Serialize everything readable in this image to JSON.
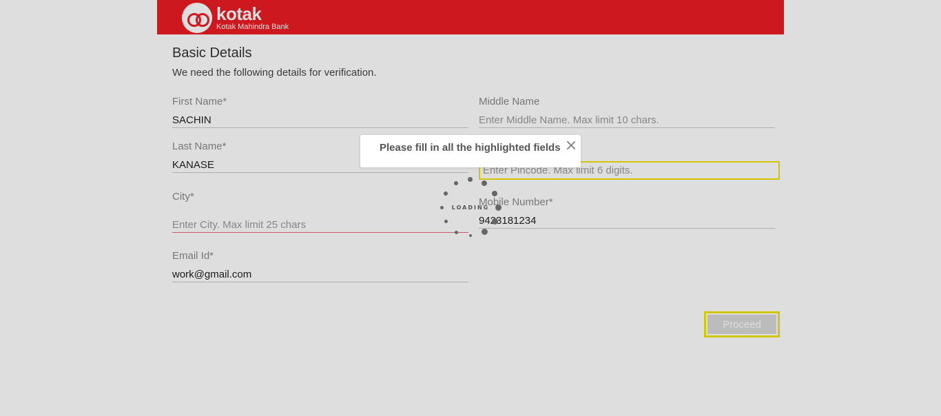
{
  "header": {
    "brand": "kotak",
    "brand_sub": "Kotak Mahindra Bank",
    "brand_color": "#ed1c24"
  },
  "section": {
    "title": "Basic Details",
    "subtitle": "We need the following details for verification."
  },
  "form": {
    "first_name": {
      "label": "First Name*",
      "value": "SACHIN"
    },
    "middle_name": {
      "label": "Middle Name",
      "placeholder": "Enter Middle Name. Max limit 10 chars."
    },
    "last_name": {
      "label": "Last Name*",
      "value": "KANASE"
    },
    "pincode": {
      "placeholder": "Enter Pincode. Max limit 6 digits."
    },
    "city": {
      "label": "City*",
      "placeholder": "Enter City. Max limit 25 chars"
    },
    "mobile": {
      "label": "Mobile Number*",
      "value": "9423181234"
    },
    "email": {
      "label": "Email Id*",
      "value": "work@gmail.com"
    }
  },
  "buttons": {
    "proceed": "Proceed"
  },
  "toast": {
    "message": "Please fill in all the highlighted fields",
    "close_icon": "close-icon"
  },
  "loader": {
    "text": "LOADING"
  },
  "colors": {
    "highlight": "#f0e400",
    "error_underline": "#e26b6b"
  }
}
